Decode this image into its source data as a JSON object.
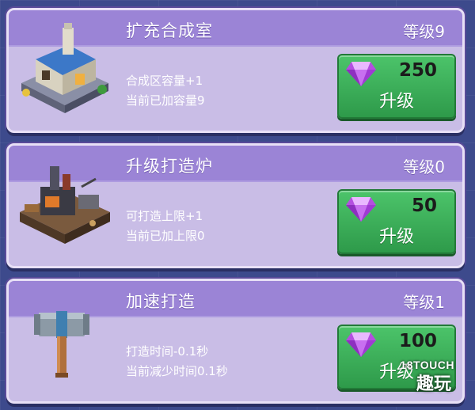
{
  "cards": [
    {
      "title": "扩充合成室",
      "level": "等级9",
      "desc1": "合成区容量+1",
      "desc2": "当前已加容量9",
      "price": "250",
      "button_label": "升级",
      "icon": "synthesis-room-building-icon"
    },
    {
      "title": "升级打造炉",
      "level": "等级0",
      "desc1": "可打造上限+1",
      "desc2": "当前已加上限0",
      "price": "50",
      "button_label": "升级",
      "icon": "forge-furnace-icon"
    },
    {
      "title": "加速打造",
      "level": "等级1",
      "desc1": "打造时间-0.1秒",
      "desc2": "当前减少时间0.1秒",
      "price": "100",
      "button_label": "升级",
      "icon": "hammer-icon"
    }
  ],
  "watermark": {
    "line1": "18TOUCH",
    "line2": "趣玩"
  },
  "colors": {
    "background": "#3d4a8c",
    "card": "#c9bde6",
    "header": "#9b84d6",
    "button": "#3cae5a",
    "gem": "#b44fe0"
  }
}
